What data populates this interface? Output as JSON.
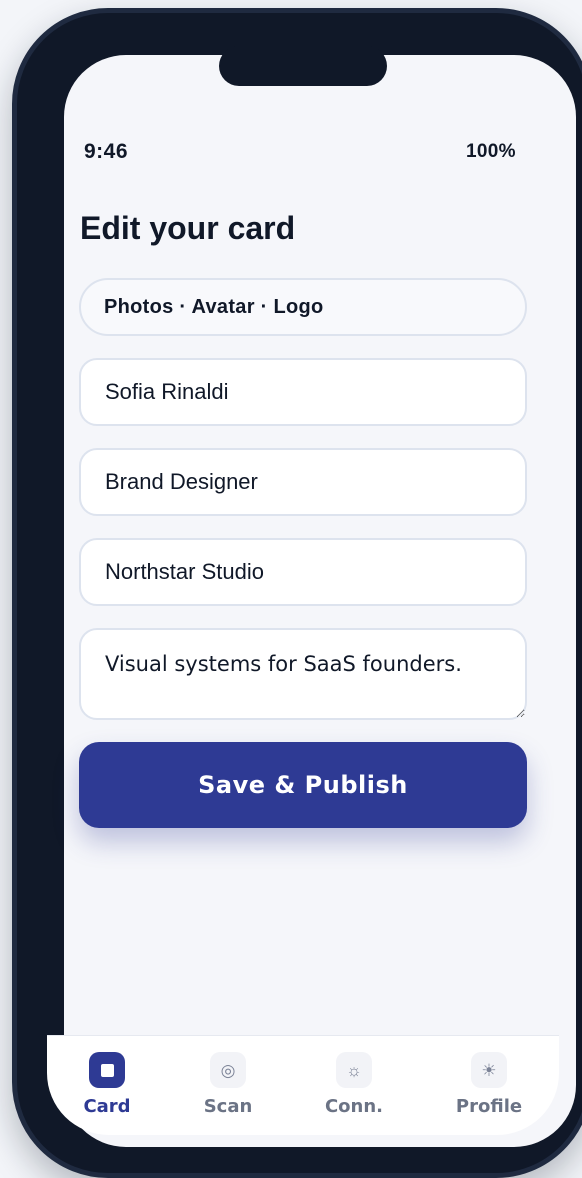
{
  "status_bar": {
    "time": "9:46",
    "battery": "100%"
  },
  "page": {
    "title": "Edit your card"
  },
  "media_pill": {
    "label": "Photos · Avatar · Logo"
  },
  "form": {
    "name": "Sofia Rinaldi",
    "role": "Brand Designer",
    "company": "Northstar Studio",
    "bio": "Visual systems for SaaS founders."
  },
  "actions": {
    "save_label": "Save & Publish"
  },
  "tabs": [
    {
      "label": "Card",
      "icon": "card-icon",
      "active": true
    },
    {
      "label": "Scan",
      "icon": "scan-icon",
      "glyph": "◎",
      "active": false
    },
    {
      "label": "Conn.",
      "icon": "connections-icon",
      "glyph": "☼",
      "active": false
    },
    {
      "label": "Profile",
      "icon": "profile-icon",
      "glyph": "☀",
      "active": false
    }
  ],
  "colors": {
    "accent": "#2E3A94",
    "text": "#101828",
    "background": "#F5F6FA",
    "tab_inactive": "#6B7385",
    "phone_frame": "#101828"
  }
}
